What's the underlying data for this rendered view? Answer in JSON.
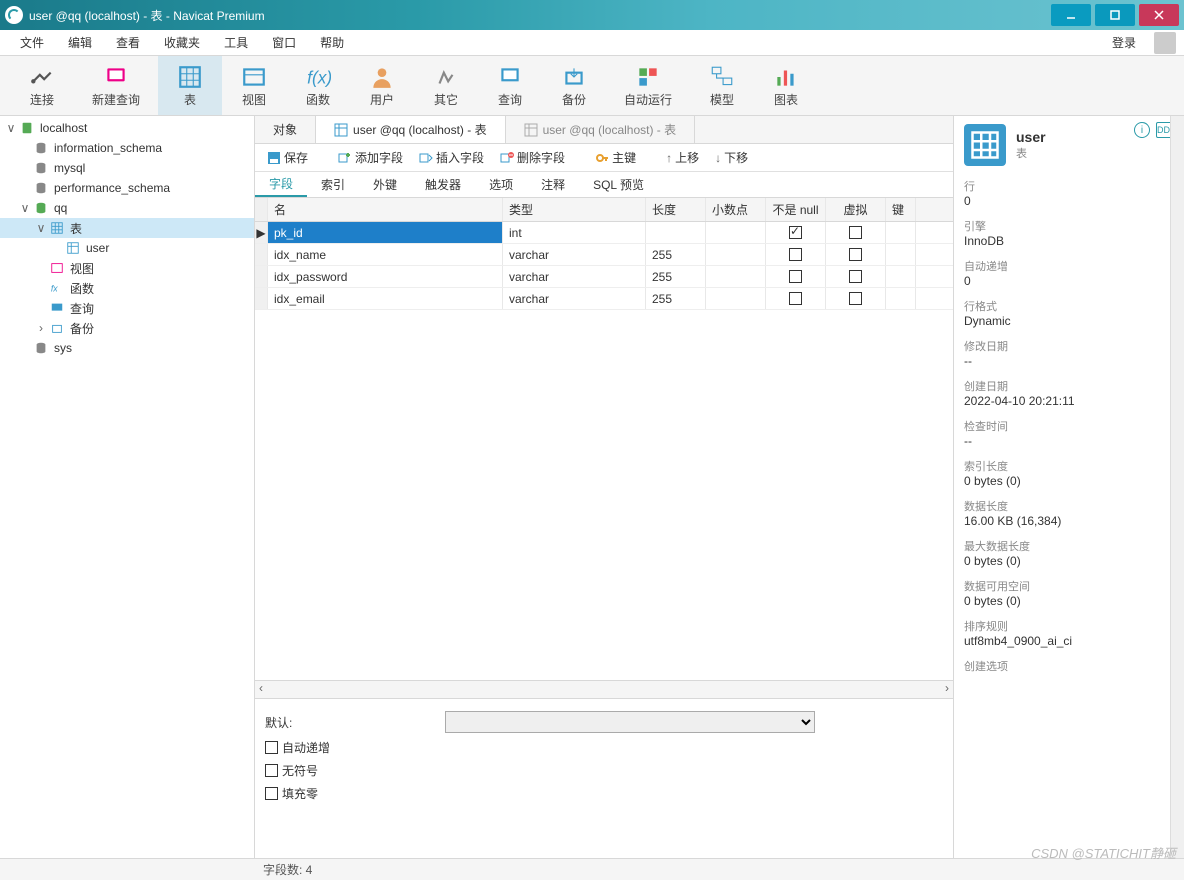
{
  "window": {
    "title": "user @qq (localhost) - 表 - Navicat Premium"
  },
  "menu": {
    "items": [
      "文件",
      "编辑",
      "查看",
      "收藏夹",
      "工具",
      "窗口",
      "帮助"
    ],
    "login": "登录"
  },
  "toolbar": {
    "items": [
      {
        "label": "连接",
        "id": "connect"
      },
      {
        "label": "新建查询",
        "id": "new-query"
      },
      {
        "label": "表",
        "id": "table",
        "active": true
      },
      {
        "label": "视图",
        "id": "view"
      },
      {
        "label": "函数",
        "id": "function"
      },
      {
        "label": "用户",
        "id": "user"
      },
      {
        "label": "其它",
        "id": "other"
      },
      {
        "label": "查询",
        "id": "query"
      },
      {
        "label": "备份",
        "id": "backup"
      },
      {
        "label": "自动运行",
        "id": "autorun"
      },
      {
        "label": "模型",
        "id": "model"
      },
      {
        "label": "图表",
        "id": "chart"
      }
    ]
  },
  "tree": {
    "root": "localhost",
    "dbs": [
      {
        "name": "information_schema"
      },
      {
        "name": "mysql"
      },
      {
        "name": "performance_schema"
      },
      {
        "name": "qq",
        "expanded": true,
        "children": [
          {
            "name": "表",
            "expanded": true,
            "selected": true,
            "children": [
              {
                "name": "user"
              }
            ]
          },
          {
            "name": "视图"
          },
          {
            "name": "函数"
          },
          {
            "name": "查询"
          },
          {
            "name": "备份"
          }
        ]
      },
      {
        "name": "sys"
      }
    ]
  },
  "tabs": {
    "items": [
      {
        "label": "对象",
        "active": false
      },
      {
        "label": "user @qq (localhost) - 表",
        "active": true
      },
      {
        "label": "user @qq (localhost) - 表",
        "active": false,
        "inactive": true
      }
    ]
  },
  "tb2": {
    "save": "保存",
    "add_field": "添加字段",
    "insert_field": "插入字段",
    "delete_field": "删除字段",
    "primary_key": "主键",
    "move_up": "上移",
    "move_down": "下移"
  },
  "subtabs": {
    "items": [
      "字段",
      "索引",
      "外键",
      "触发器",
      "选项",
      "注释",
      "SQL 预览"
    ],
    "active": 0
  },
  "grid": {
    "cols": {
      "name": "名",
      "type": "类型",
      "len": "长度",
      "dec": "小数点",
      "null": "不是 null",
      "virt": "虚拟",
      "key": "键"
    },
    "rows": [
      {
        "name": "pk_id",
        "type": "int",
        "len": "",
        "dec": "",
        "null": true,
        "virt": false,
        "selected": true
      },
      {
        "name": "idx_name",
        "type": "varchar",
        "len": "255",
        "dec": "",
        "null": false,
        "virt": false
      },
      {
        "name": "idx_password",
        "type": "varchar",
        "len": "255",
        "dec": "",
        "null": false,
        "virt": false
      },
      {
        "name": "idx_email",
        "type": "varchar",
        "len": "255",
        "dec": "",
        "null": false,
        "virt": false
      }
    ]
  },
  "lower": {
    "default": "默认:",
    "auto_inc": "自动递增",
    "unsigned": "无符号",
    "zerofill": "填充零"
  },
  "right": {
    "title": "user",
    "subtitle": "表",
    "info_icon": "ⓘ",
    "ddl_icon": "DDL",
    "props": [
      {
        "k": "行",
        "v": "0"
      },
      {
        "k": "引擎",
        "v": "InnoDB"
      },
      {
        "k": "自动递增",
        "v": "0"
      },
      {
        "k": "行格式",
        "v": "Dynamic"
      },
      {
        "k": "修改日期",
        "v": "--"
      },
      {
        "k": "创建日期",
        "v": "2022-04-10 20:21:11"
      },
      {
        "k": "检查时间",
        "v": "--"
      },
      {
        "k": "索引长度",
        "v": "0 bytes (0)"
      },
      {
        "k": "数据长度",
        "v": "16.00 KB (16,384)"
      },
      {
        "k": "最大数据长度",
        "v": "0 bytes (0)"
      },
      {
        "k": "数据可用空间",
        "v": "0 bytes (0)"
      },
      {
        "k": "排序规则",
        "v": "utf8mb4_0900_ai_ci"
      },
      {
        "k": "创建选项",
        "v": ""
      }
    ]
  },
  "status": {
    "fields": "字段数: 4"
  },
  "watermark": "CSDN @STATICHIT静砸"
}
